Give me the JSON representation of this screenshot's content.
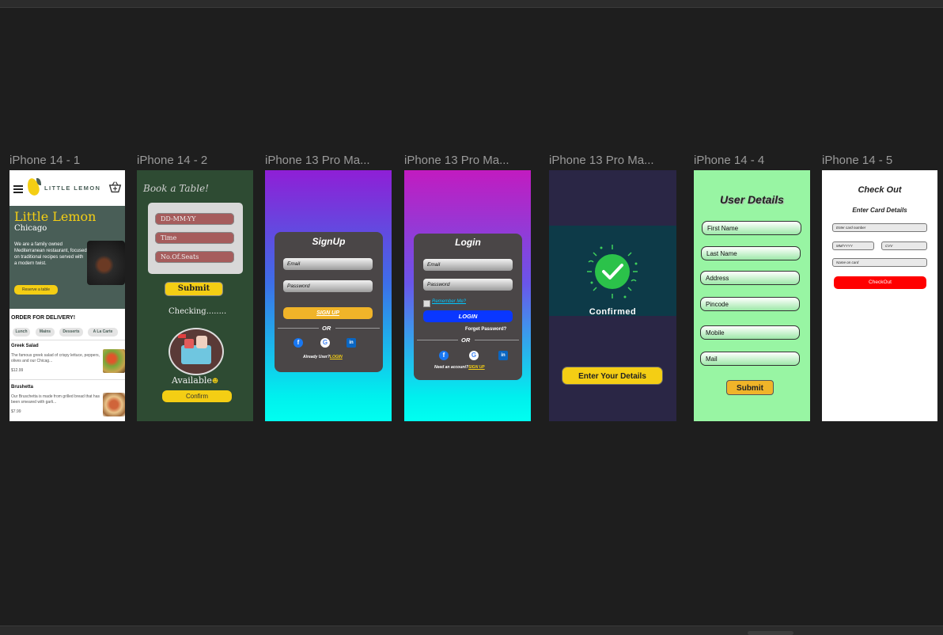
{
  "canvas": {
    "background": "#1e1e1e"
  },
  "frames": {
    "f1": {
      "label": "iPhone 14 - 1",
      "brand": "LITTLE LEMON",
      "hero_title": "Little Lemon",
      "hero_subtitle": "Chicago",
      "hero_description": "We are a family owned Mediterranean restaurant, focused on traditional recipes served with a modern twist.",
      "reserve_button": "Reserve a table",
      "delivery_heading": "ORDER FOR DELIVERY!",
      "categories": [
        "Lunch",
        "Mains",
        "Desserts",
        "A La Carte"
      ],
      "dishes": [
        {
          "name": "Greek Salad",
          "description": "The famous greek salad of crispy lettuce, peppers, olives and our Chicag...",
          "price": "$12.99"
        },
        {
          "name": "Brushetta",
          "description": "Our Bruschetta is made from grilled bread that has been smeared with garli...",
          "price": "$7.99"
        }
      ]
    },
    "f2": {
      "label": "iPhone 14 - 2",
      "title": "Book a Table!",
      "fields": [
        "DD-MM-YY",
        "Time",
        "No.Of.Seats"
      ],
      "submit": "Submit",
      "checking": "Checking........",
      "available": "Available",
      "confirm": "Confirm"
    },
    "f3": {
      "label": "iPhone 13 Pro Ma...",
      "title": "SignUp",
      "email": "Email",
      "password": "Password",
      "signup_button": "SIGN UP",
      "or": "OR",
      "footer_text": "Already User?",
      "footer_link": "LOGIN"
    },
    "f4": {
      "label": "iPhone 13 Pro Ma...",
      "title": "Login",
      "email": "Email",
      "password": "Password",
      "remember": "Remember Me?",
      "login_button": "LOGIN",
      "forgot": "Forget Password?",
      "or": "OR",
      "footer_text": "Need an account?",
      "footer_link": "SIGN UP"
    },
    "f5": {
      "label": "iPhone 13 Pro Ma...",
      "confirmed": "Confirmed",
      "button": "Enter Your Details"
    },
    "f6": {
      "label": "iPhone 14 - 4",
      "title": "User Details",
      "fields": [
        "First Name",
        "Last Name",
        "Address",
        "Pincode",
        "Mobile",
        "Mail"
      ],
      "submit": "Submit"
    },
    "f7": {
      "label": "iPhone 14 - 5",
      "title": "Check Out",
      "subtitle": "Enter Card Details",
      "card_number": "Enter card number",
      "expiry": "MM/YYYY",
      "cvv": "CVV",
      "name_on_card": "Name on card",
      "checkout_button": "CheckOut"
    }
  },
  "colors": {
    "lemon_yellow": "#f4ce14",
    "lemon_green": "#495e57",
    "book_bg": "#2e4b33",
    "login_blue": "#0a37ff",
    "user_details_bg": "#98f5a3",
    "checkout_red": "#ff0000",
    "confirm_bg": "#2a2645"
  },
  "icons": [
    "hamburger-icon",
    "lemon-logo-icon",
    "basket-icon",
    "facebook-icon",
    "google-icon",
    "linkedin-icon",
    "check-circle-icon"
  ]
}
